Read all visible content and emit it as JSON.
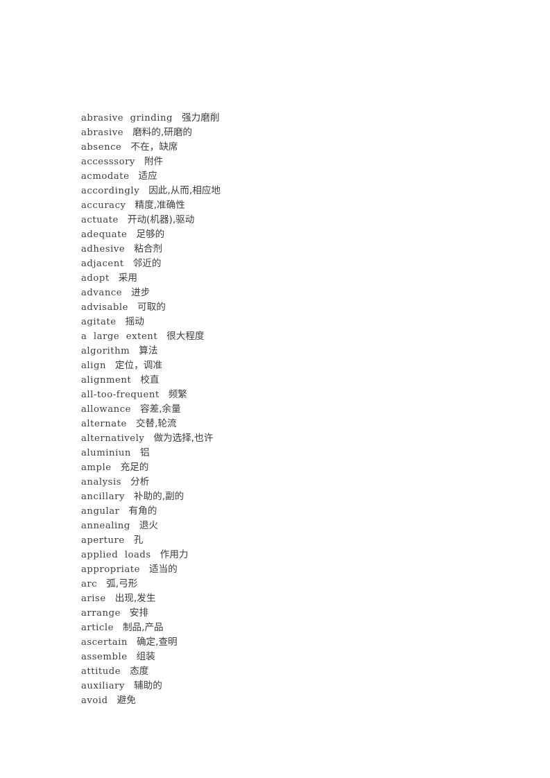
{
  "document": {
    "type": "vocabulary-glossary",
    "language_pair": "English-Chinese",
    "section": "A",
    "entry_count": 41,
    "text_color": "#3d3d3d",
    "background_color": "#ffffff"
  },
  "entries": [
    {
      "term": "abrasive  grinding",
      "gloss": "强力磨削"
    },
    {
      "term": "abrasive",
      "gloss": "磨料的,研磨的"
    },
    {
      "term": "absence",
      "gloss": "不在，缺席"
    },
    {
      "term": "accesssory",
      "gloss": "附件"
    },
    {
      "term": "acmodate",
      "gloss": "适应"
    },
    {
      "term": "accordingly",
      "gloss": "因此,从而,相应地"
    },
    {
      "term": "accuracy",
      "gloss": "精度,准确性"
    },
    {
      "term": "actuate",
      "gloss": "开动(机器),驱动"
    },
    {
      "term": "adequate",
      "gloss": "足够的"
    },
    {
      "term": "adhesive",
      "gloss": "粘合剂"
    },
    {
      "term": "adjacent",
      "gloss": "邻近的"
    },
    {
      "term": "adopt",
      "gloss": "采用"
    },
    {
      "term": "advance",
      "gloss": "进步"
    },
    {
      "term": "advisable",
      "gloss": "可取的"
    },
    {
      "term": "agitate",
      "gloss": "摇动"
    },
    {
      "term": "a  large  extent",
      "gloss": "很大程度"
    },
    {
      "term": "algorithm",
      "gloss": "算法"
    },
    {
      "term": "align",
      "gloss": "定位，调准"
    },
    {
      "term": "alignment",
      "gloss": "校直"
    },
    {
      "term": "all-too-frequent",
      "gloss": "频繁"
    },
    {
      "term": "allowance",
      "gloss": "容差,余量"
    },
    {
      "term": "alternate",
      "gloss": "交替,轮流"
    },
    {
      "term": "alternatively",
      "gloss": "做为选择,也许"
    },
    {
      "term": "aluminiun",
      "gloss": "铝"
    },
    {
      "term": "ample",
      "gloss": "充足的"
    },
    {
      "term": "analysis",
      "gloss": "分析"
    },
    {
      "term": "ancillary",
      "gloss": "补助的,副的"
    },
    {
      "term": "angular",
      "gloss": "有角的"
    },
    {
      "term": "annealing",
      "gloss": "退火"
    },
    {
      "term": "aperture",
      "gloss": "孔"
    },
    {
      "term": "applied  loads",
      "gloss": "作用力"
    },
    {
      "term": "appropriate",
      "gloss": "适当的"
    },
    {
      "term": "arc",
      "gloss": "弧,弓形"
    },
    {
      "term": "arise",
      "gloss": "出现,发生"
    },
    {
      "term": "arrange",
      "gloss": "安排"
    },
    {
      "term": "article",
      "gloss": "制品,产品"
    },
    {
      "term": "ascertain",
      "gloss": "确定,查明"
    },
    {
      "term": "assemble",
      "gloss": "组装"
    },
    {
      "term": "attitude",
      "gloss": "态度"
    },
    {
      "term": "auxiliary",
      "gloss": "辅助的"
    },
    {
      "term": "avoid",
      "gloss": "避免"
    }
  ]
}
